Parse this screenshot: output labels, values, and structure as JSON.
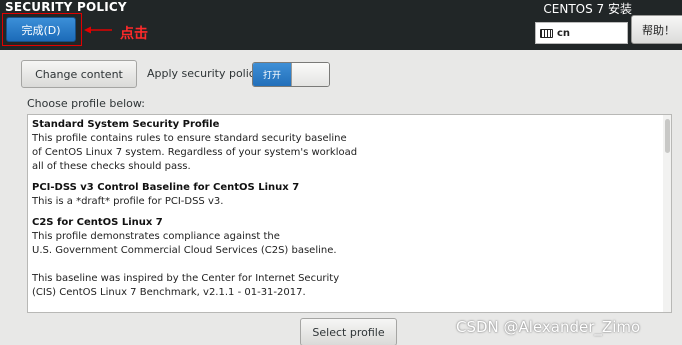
{
  "header": {
    "page_title": "SECURITY POLICY",
    "product_title": "CENTOS 7 安装",
    "done_button": "完成(D)",
    "annotation": "点击",
    "keyboard_layout": "cn",
    "help_button": "帮助！"
  },
  "toolbar": {
    "change_content": "Change content",
    "apply_label": "Apply security policy:",
    "toggle_state": "打开",
    "choose_label": "Choose profile below:"
  },
  "profiles": [
    {
      "title": "Standard System Security Profile",
      "lines": [
        "This profile contains rules to ensure standard security baseline",
        "of CentOS Linux 7 system. Regardless of your system's workload",
        "all of these checks should pass."
      ]
    },
    {
      "title": "PCI-DSS v3 Control Baseline for CentOS Linux 7",
      "lines": [
        "This is a *draft* profile for PCI-DSS v3."
      ]
    },
    {
      "title": "C2S for CentOS Linux 7",
      "lines": [
        "This profile demonstrates compliance against the",
        "U.S. Government Commercial Cloud Services (C2S) baseline.",
        "",
        "This baseline was inspired by the Center for Internet Security",
        "(CIS) CentOS Linux 7 Benchmark, v2.1.1 - 01-31-2017."
      ]
    }
  ],
  "footer": {
    "select_profile": "Select profile",
    "watermark": "CSDN @Alexander_Zimo"
  },
  "colors": {
    "header_bg": "#212627",
    "accent_blue": "#1c6bb8",
    "annotation_red": "#ff2a2a"
  }
}
